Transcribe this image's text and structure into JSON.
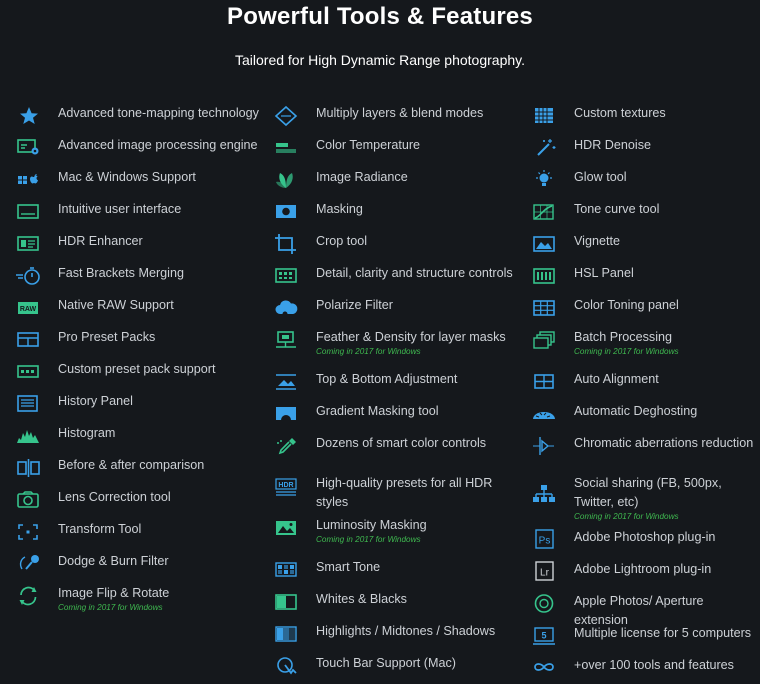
{
  "title": "Powerful Tools & Features",
  "subtitle": "Tailored for High Dynamic Range photography.",
  "colors": {
    "accent_blue": "#3aa0e8",
    "accent_green": "#36c48c",
    "note_green": "#3fb950"
  },
  "features": {
    "col1": [
      {
        "label": "Advanced tone-mapping technology",
        "icon": "star-icon"
      },
      {
        "label": "Advanced image processing engine",
        "icon": "screen-gear-icon"
      },
      {
        "label": "Mac & Windows Support",
        "icon": "windows-apple-icon"
      },
      {
        "label": "Intuitive user interface",
        "icon": "interface-icon"
      },
      {
        "label": "HDR Enhancer",
        "icon": "enhancer-icon"
      },
      {
        "label": "Fast Brackets Merging",
        "icon": "stopwatch-icon"
      },
      {
        "label": "Native RAW Support",
        "icon": "raw-icon",
        "icon_text": "RAW"
      },
      {
        "label": "Pro Preset Packs",
        "icon": "preset-packs-icon"
      },
      {
        "label": "Custom preset pack support",
        "icon": "custom-preset-icon"
      },
      {
        "label": "History Panel",
        "icon": "history-panel-icon"
      },
      {
        "label": "Histogram",
        "icon": "histogram-icon"
      },
      {
        "label": "Before & after comparison",
        "icon": "before-after-icon"
      },
      {
        "label": "Lens Correction tool",
        "icon": "lens-correction-icon"
      },
      {
        "label": "Transform Tool",
        "icon": "transform-icon"
      },
      {
        "label": "Dodge & Burn Filter",
        "icon": "dodge-burn-icon"
      },
      {
        "label": "Image Flip & Rotate",
        "icon": "rotate-icon",
        "note": "Coming in 2017 for Windows"
      }
    ],
    "col2": [
      {
        "label": "Multiply layers & blend modes",
        "icon": "layers-icon"
      },
      {
        "label": "Color Temperature",
        "icon": "color-temperature-icon"
      },
      {
        "label": "Image Radiance",
        "icon": "radiance-icon"
      },
      {
        "label": "Masking",
        "icon": "masking-icon"
      },
      {
        "label": "Crop tool",
        "icon": "crop-icon"
      },
      {
        "label": "Detail, clarity and structure controls",
        "icon": "detail-controls-icon"
      },
      {
        "label": "Polarize Filter",
        "icon": "polarize-icon"
      },
      {
        "label": "Feather & Density for layer masks",
        "icon": "feather-density-icon",
        "note": "Coming in 2017 for Windows"
      },
      {
        "label": "Top & Bottom Adjustment",
        "icon": "top-bottom-icon"
      },
      {
        "label": "Gradient Masking tool",
        "icon": "gradient-mask-icon"
      },
      {
        "label": "Dozens of smart color controls",
        "icon": "eyedropper-icon"
      },
      {
        "label": "High-quality presets for all HDR styles",
        "icon": "hdr-presets-icon",
        "icon_text": "HDR"
      },
      {
        "label": "Luminosity Masking",
        "icon": "luminosity-mask-icon",
        "note": "Coming in 2017 for Windows"
      },
      {
        "label": "Smart Tone",
        "icon": "smart-tone-icon"
      },
      {
        "label": "Whites & Blacks",
        "icon": "whites-blacks-icon"
      },
      {
        "label": "Highlights / Midtones / Shadows",
        "icon": "highlights-icon"
      },
      {
        "label": "Touch Bar Support (Mac)",
        "icon": "touch-bar-icon"
      }
    ],
    "col3": [
      {
        "label": "Custom textures",
        "icon": "textures-icon"
      },
      {
        "label": "HDR Denoise",
        "icon": "denoise-wand-icon"
      },
      {
        "label": "Glow tool",
        "icon": "glow-bulb-icon"
      },
      {
        "label": "Tone curve tool",
        "icon": "tone-curve-icon"
      },
      {
        "label": "Vignette",
        "icon": "vignette-icon"
      },
      {
        "label": "HSL Panel",
        "icon": "hsl-panel-icon"
      },
      {
        "label": "Color Toning panel",
        "icon": "color-toning-icon"
      },
      {
        "label": "Batch Processing",
        "icon": "batch-icon",
        "note": "Coming in 2017 for Windows"
      },
      {
        "label": "Auto Alignment",
        "icon": "alignment-icon"
      },
      {
        "label": "Automatic Deghosting",
        "icon": "deghosting-icon"
      },
      {
        "label": "Chromatic aberrations reduction",
        "icon": "chromatic-icon"
      },
      {
        "label": "Social sharing (FB, 500px, Twitter, etc)",
        "icon": "share-network-icon",
        "note": "Coming in 2017 for Windows"
      },
      {
        "label": "Adobe Photoshop plug-in",
        "icon": "photoshop-icon",
        "icon_text": "Ps"
      },
      {
        "label": "Adobe Lightroom plug-in",
        "icon": "lightroom-icon",
        "icon_text": "Lr"
      },
      {
        "label": "Apple Photos/ Aperture extension",
        "icon": "aperture-icon"
      },
      {
        "label": "Multiple license for 5 computers",
        "icon": "license-icon",
        "icon_text": "5"
      },
      {
        "label": "+over 100 tools and features",
        "icon": "infinity-icon"
      }
    ]
  }
}
